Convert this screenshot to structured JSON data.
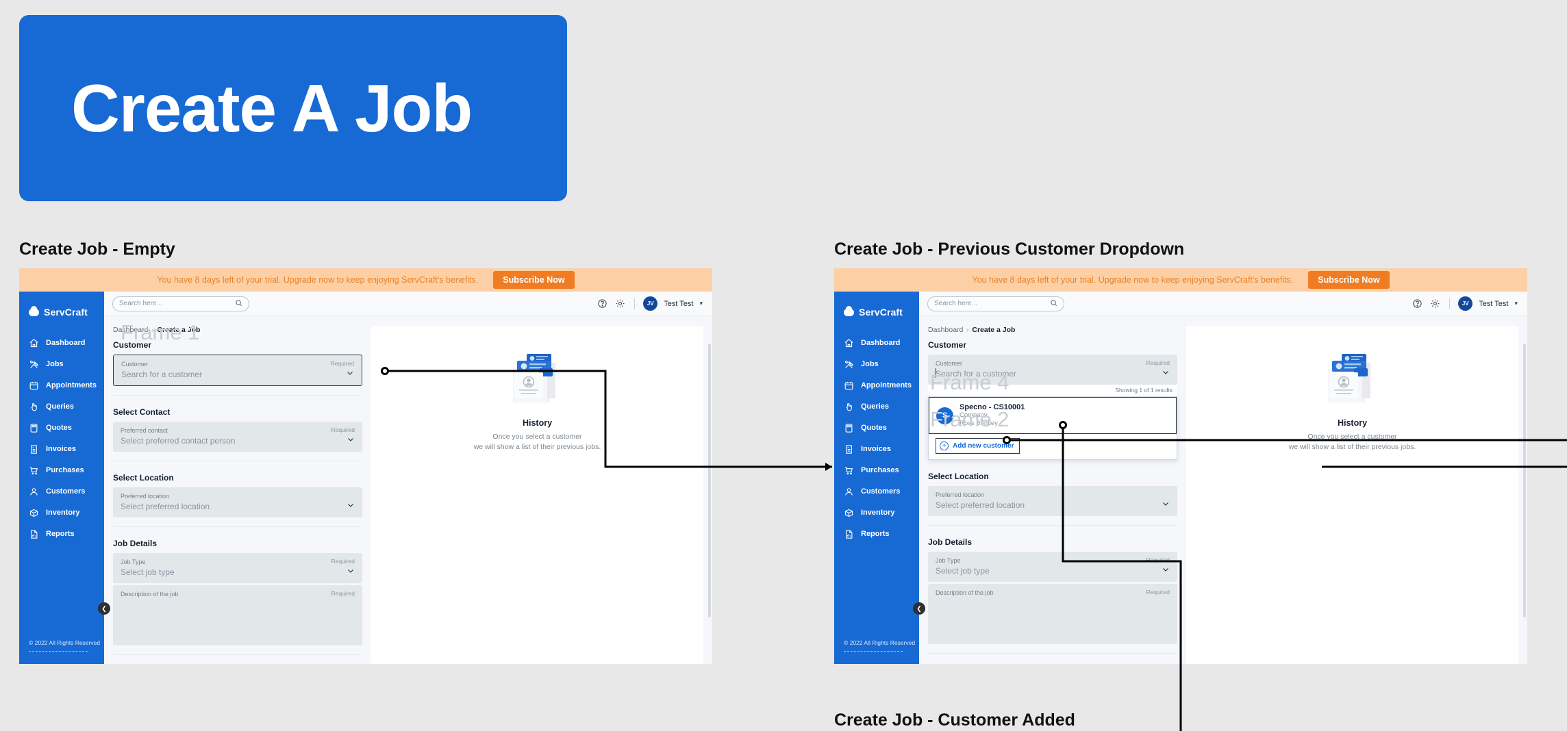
{
  "hero": {
    "title": "Create A Job"
  },
  "captions": {
    "frame1": "Create Job - Empty",
    "frame2": "Create Job - Previous Customer Dropdown",
    "frame3": "Create Job - Customer Added"
  },
  "watermarks": {
    "frame1": "Frame 1",
    "frame4": "Frame 4",
    "frame2": "Frame 2"
  },
  "colors": {
    "brand_blue": "#1769d4",
    "banner_bg": "#fcd0a4",
    "banner_text": "#e8822a",
    "subscribe_btn": "#f07c24",
    "field_bg": "#e2e7ea",
    "page_bg": "#e8e8e8"
  },
  "banner": {
    "text": "You have 8 days left of your trial. Upgrade now to keep enjoying ServCraft's benefits.",
    "cta": "Subscribe Now"
  },
  "sidebar": {
    "brand": "ServCraft",
    "brand_logo_icon": "cloud-icon",
    "copyright": "© 2022 All Rights Reserved",
    "collapse_icon": "chevron-left-icon",
    "items": [
      {
        "label": "Dashboard",
        "icon": "home-icon"
      },
      {
        "label": "Jobs",
        "icon": "tools-icon"
      },
      {
        "label": "Appointments",
        "icon": "calendar-icon"
      },
      {
        "label": "Queries",
        "icon": "hand-pointer-icon"
      },
      {
        "label": "Quotes",
        "icon": "calculator-icon"
      },
      {
        "label": "Invoices",
        "icon": "invoice-icon"
      },
      {
        "label": "Purchases",
        "icon": "cart-icon"
      },
      {
        "label": "Customers",
        "icon": "user-icon"
      },
      {
        "label": "Inventory",
        "icon": "box-icon"
      },
      {
        "label": "Reports",
        "icon": "report-icon"
      }
    ]
  },
  "topbar": {
    "search_placeholder": "Search here...",
    "search_value": "",
    "search_icon": "search-icon",
    "help_icon": "help-circle-icon",
    "settings_icon": "gear-icon",
    "avatar_initials": "JV",
    "user_name": "Test Test",
    "caret_icon": "chevron-down-icon"
  },
  "breadcrumb": {
    "root": "Dashboard",
    "separator": "›",
    "current": "Create a Job"
  },
  "form": {
    "sections": {
      "customer": "Customer",
      "select_contact": "Select Contact",
      "select_location": "Select Location",
      "job_details": "Job Details"
    },
    "required_label": "Required",
    "fields": {
      "customer": {
        "label": "Customer",
        "placeholder": "Search for a customer"
      },
      "contact": {
        "label": "Preferred contact",
        "placeholder": "Select preferred contact person"
      },
      "location": {
        "label": "Preferred location",
        "placeholder": "Select preferred location"
      },
      "job_type": {
        "label": "Job Type",
        "placeholder": "Select job type"
      },
      "description": {
        "label": "Description of the job",
        "placeholder": ""
      }
    }
  },
  "dropdown": {
    "results_meta": "Showing 1 of 1 results",
    "result": {
      "avatar_initial": "S",
      "name": "Specno - CS10001",
      "type": "Company",
      "contact": "Ross Bentley"
    },
    "add_new_label": "Add new customer",
    "add_new_icon": "plus-circle-icon"
  },
  "history": {
    "title": "History",
    "line1": "Once you select a customer",
    "line2": "we will show a list of their previous jobs.",
    "illustration_icon": "job-cards-illustration"
  }
}
